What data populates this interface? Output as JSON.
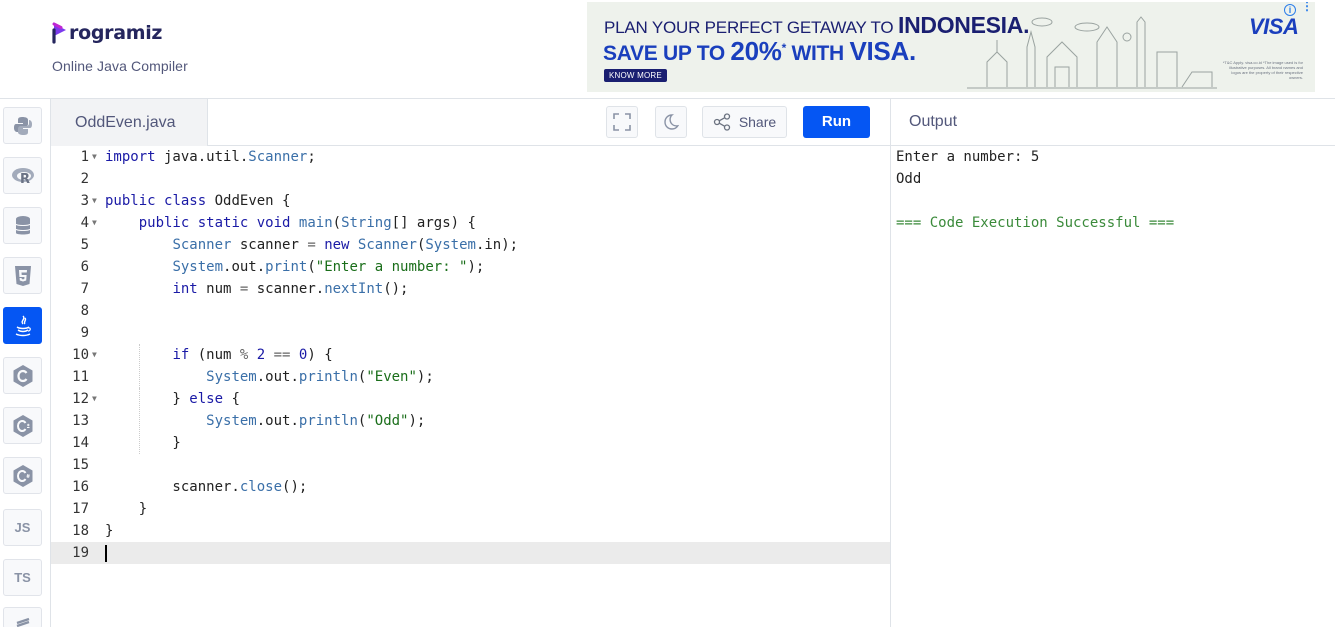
{
  "header": {
    "logo_text": "rogramiz",
    "subtitle": "Online Java Compiler"
  },
  "ad": {
    "line1_prefix": "PLAN YOUR PERFECT GETAWAY TO ",
    "line1_bold": "INDONESIA.",
    "line2_prefix": "SAVE UP TO ",
    "line2_big": "20%",
    "line2_sup": "*",
    "line2_suffix": " WITH ",
    "line2_brand": "VISA.",
    "cta": "KNOW MORE",
    "brand_logo": "VISA",
    "fine_print": "*T&C Apply. visa.co.id *The image used is for illustrative purposes. All brand names and logos are the property of their respective owners.",
    "info": "i"
  },
  "sidebar": {
    "languages": [
      {
        "name": "python-icon",
        "label": ""
      },
      {
        "name": "r-icon",
        "label": ""
      },
      {
        "name": "sql-icon",
        "label": ""
      },
      {
        "name": "html5-icon",
        "label": ""
      },
      {
        "name": "java-icon",
        "label": "",
        "active": true
      },
      {
        "name": "c-icon",
        "label": ""
      },
      {
        "name": "cpp-icon",
        "label": ""
      },
      {
        "name": "csharp-icon",
        "label": ""
      },
      {
        "name": "js-icon",
        "label": "JS"
      },
      {
        "name": "ts-icon",
        "label": "TS"
      },
      {
        "name": "go-icon",
        "label": ""
      }
    ]
  },
  "editor": {
    "file_name": "OddEven.java",
    "share_label": "Share",
    "run_label": "Run",
    "current_line": 19,
    "lines": [
      {
        "n": "1",
        "fold": true,
        "text": "import java.util.Scanner;"
      },
      {
        "n": "2",
        "fold": false,
        "text": ""
      },
      {
        "n": "3",
        "fold": true,
        "text": "public class OddEven {"
      },
      {
        "n": "4",
        "fold": true,
        "text": "    public static void main(String[] args) {"
      },
      {
        "n": "5",
        "fold": false,
        "text": "        Scanner scanner = new Scanner(System.in);"
      },
      {
        "n": "6",
        "fold": false,
        "text": "        System.out.print(\"Enter a number: \");"
      },
      {
        "n": "7",
        "fold": false,
        "text": "        int num = scanner.nextInt();"
      },
      {
        "n": "8",
        "fold": false,
        "text": ""
      },
      {
        "n": "9",
        "fold": false,
        "text": ""
      },
      {
        "n": "10",
        "fold": true,
        "text": "        if (num % 2 == 0) {"
      },
      {
        "n": "11",
        "fold": false,
        "text": "            System.out.println(\"Even\");"
      },
      {
        "n": "12",
        "fold": true,
        "text": "        } else {"
      },
      {
        "n": "13",
        "fold": false,
        "text": "            System.out.println(\"Odd\");"
      },
      {
        "n": "14",
        "fold": false,
        "text": "        }"
      },
      {
        "n": "15",
        "fold": false,
        "text": ""
      },
      {
        "n": "16",
        "fold": false,
        "text": "        scanner.close();"
      },
      {
        "n": "17",
        "fold": false,
        "text": "    }"
      },
      {
        "n": "18",
        "fold": false,
        "text": "}"
      },
      {
        "n": "19",
        "fold": false,
        "text": ""
      }
    ]
  },
  "output": {
    "title": "Output",
    "lines": [
      {
        "text": "Enter a number: 5",
        "kind": "normal"
      },
      {
        "text": "Odd",
        "kind": "normal"
      },
      {
        "text": "",
        "kind": "normal"
      },
      {
        "text": "=== Code Execution Successful ===",
        "kind": "success"
      }
    ]
  },
  "colors": {
    "accent": "#0556f3",
    "success": "#3a8a3a",
    "brand_dark": "#25265e"
  }
}
